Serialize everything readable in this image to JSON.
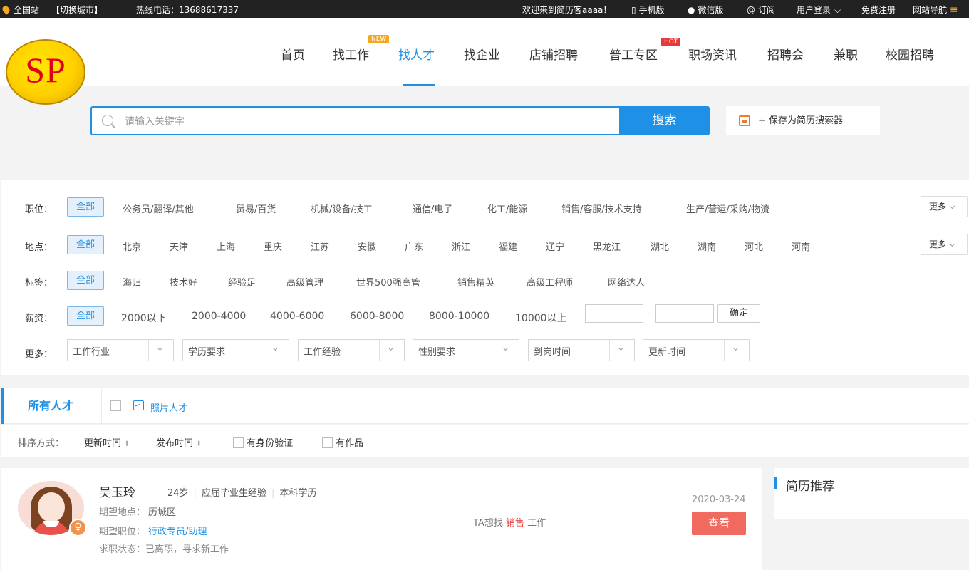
{
  "topbar": {
    "site": "全国站",
    "switch_city": "【切换城市】",
    "hotline": "热线电话：13688617337",
    "welcome": "欢迎来到简历客aaaa！",
    "mobile": "手机版",
    "wechat": "微信版",
    "subscribe": "订阅",
    "login": "用户登录",
    "register": "免费注册",
    "site_nav": "网站导航"
  },
  "logo": {
    "text": "SP"
  },
  "nav": {
    "items": [
      {
        "label": "首页"
      },
      {
        "label": "找工作",
        "badge": "NEW"
      },
      {
        "label": "找人才",
        "active": true
      },
      {
        "label": "找企业"
      },
      {
        "label": "店铺招聘"
      },
      {
        "label": "普工专区",
        "badge": "HOT"
      },
      {
        "label": "职场资讯"
      },
      {
        "label": "招聘会"
      },
      {
        "label": "兼职"
      },
      {
        "label": "校园招聘"
      }
    ]
  },
  "search": {
    "placeholder": "请输入关键字",
    "button": "搜索",
    "save": "+ 保存为简历搜索器"
  },
  "filters": {
    "position": {
      "label": "职位：",
      "items": [
        "全部",
        "公务员/翻译/其他",
        "贸易/百货",
        "机械/设备/技工",
        "通信/电子",
        "化工/能源",
        "销售/客服/技术支持",
        "生产/营运/采购/物流"
      ],
      "more": "更多"
    },
    "location": {
      "label": "地点：",
      "items": [
        "全部",
        "北京",
        "天津",
        "上海",
        "重庆",
        "江苏",
        "安徽",
        "广东",
        "浙江",
        "福建",
        "辽宁",
        "黑龙江",
        "湖北",
        "湖南",
        "河北",
        "河南"
      ],
      "more": "更多"
    },
    "tags": {
      "label": "标签：",
      "items": [
        "全部",
        "海归",
        "技术好",
        "经验足",
        "高级管理",
        "世界500强高管",
        "销售精英",
        "高级工程师",
        "网络达人"
      ]
    },
    "salary": {
      "label": "薪资：",
      "items": [
        "全部",
        "2000以下",
        "2000-4000",
        "4000-6000",
        "6000-8000",
        "8000-10000",
        "10000以上"
      ],
      "dash": "-",
      "confirm": "确定"
    },
    "more": {
      "label": "更多：",
      "dropdowns": [
        "工作行业",
        "学历要求",
        "工作经验",
        "性别要求",
        "到岗时间",
        "更新时间"
      ]
    }
  },
  "tabs": {
    "all": "所有人才",
    "photo": "照片人才"
  },
  "sort": {
    "label": "排序方式：",
    "update_time": "更新时间",
    "publish_time": "发布时间",
    "id_verified": "有身份验证",
    "has_works": "有作品"
  },
  "resume": {
    "name": "吴玉玲",
    "age": "24岁",
    "experience": "应届毕业生经验",
    "education": "本科学历",
    "expected_location_label": "期望地点：",
    "expected_location": "历城区",
    "expected_position_label": "期望职位：",
    "expected_position": "行政专员/助理",
    "status_label": "求职状态：",
    "status": "已离职，寻求新工作",
    "wants_prefix": "TA想找",
    "wants_job": "销售",
    "wants_suffix": "工作",
    "date": "2020-03-24",
    "view": "查看"
  },
  "sidebar": {
    "title": "简历推荐"
  }
}
